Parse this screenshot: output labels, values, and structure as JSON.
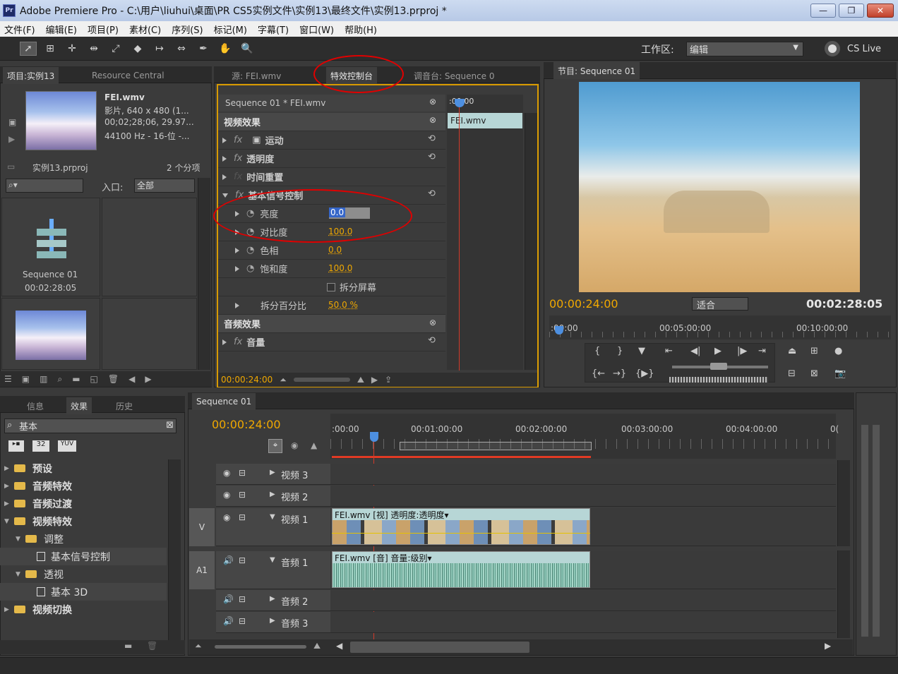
{
  "window": {
    "title": "Adobe Premiere Pro - C:\\用户\\liuhui\\桌面\\PR CS5实例文件\\实例13\\最终文件\\实例13.prproj *",
    "icon": "Pr",
    "min": "—",
    "max": "❐",
    "close": "✕"
  },
  "menu": [
    "文件(F)",
    "编辑(E)",
    "项目(P)",
    "素材(C)",
    "序列(S)",
    "标记(M)",
    "字幕(T)",
    "窗口(W)",
    "帮助(H)"
  ],
  "toolbar": {
    "tools": [
      "selection-tool",
      "track-select-tool",
      "ripple-edit-tool",
      "rolling-edit-tool",
      "rate-stretch-tool",
      "razor-tool",
      "slip-tool",
      "slide-tool",
      "pen-tool",
      "hand-tool",
      "zoom-tool"
    ],
    "glyphs": [
      "➚",
      "⊞",
      "✛",
      "⇹",
      "⤢",
      "◆",
      "↦",
      "⇔",
      "✒",
      "✋",
      "🔍"
    ],
    "workspace_label": "工作区:",
    "workspace_value": "编辑",
    "cslive": "CS Live"
  },
  "project": {
    "tabs": [
      "项目:实例13",
      "Resource Central"
    ],
    "clip_name": "FEI.wmv",
    "clip_line1": "影片, 640 x 480 (1...",
    "clip_line2": "00;02;28;06, 29.97...",
    "clip_line3": "44100 Hz - 16-位 -...",
    "project_file": "实例13.prproj",
    "item_count": "2 个分项",
    "in_label": "入口:",
    "in_value": "全部",
    "seq_name": "Sequence 01",
    "seq_duration": "00:02:28:05"
  },
  "effect_controls": {
    "tabs": [
      "源: FEI.wmv",
      "特效控制台",
      "调音台: Sequence 0"
    ],
    "clip_path": "Sequence 01 * FEI.wmv",
    "time_head": ":00:00",
    "clip_bar": "FEI.wmv",
    "video_effects": "视频效果",
    "effects": [
      "运动",
      "透明度",
      "时间重置",
      "基本信号控制"
    ],
    "params": [
      {
        "label": "亮度",
        "value": "0.0"
      },
      {
        "label": "对比度",
        "value": "100.0"
      },
      {
        "label": "色相",
        "value": "0.0"
      },
      {
        "label": "饱和度",
        "value": "100.0"
      }
    ],
    "split_screen": "拆分屏幕",
    "split_percent_label": "拆分百分比",
    "split_percent_value": "50.0 %",
    "audio_effects": "音频效果",
    "volume": "音量",
    "timecode": "00:00:24:00"
  },
  "program": {
    "tab": "节目: Sequence 01",
    "timecode": "00:00:24:00",
    "fit": "适合",
    "duration": "00:02:28:05",
    "ruler": [
      ":00:00",
      "00:05:00:00",
      "00:10:00:00"
    ]
  },
  "effects_panel": {
    "tabs": [
      "信息",
      "效果",
      "历史"
    ],
    "search": "基本",
    "badges": [
      "32",
      "YUV"
    ],
    "tree": [
      {
        "label": "预设",
        "level": 0,
        "kind": "folder"
      },
      {
        "label": "音频特效",
        "level": 0,
        "kind": "folder"
      },
      {
        "label": "音频过渡",
        "level": 0,
        "kind": "folder"
      },
      {
        "label": "视频特效",
        "level": 0,
        "kind": "folder"
      },
      {
        "label": "调整",
        "level": 1,
        "kind": "folder"
      },
      {
        "label": "基本信号控制",
        "level": 2,
        "kind": "effect"
      },
      {
        "label": "透视",
        "level": 1,
        "kind": "folder"
      },
      {
        "label": "基本 3D",
        "level": 2,
        "kind": "effect"
      },
      {
        "label": "视频切换",
        "level": 0,
        "kind": "folder"
      }
    ]
  },
  "timeline": {
    "tab": "Sequence 01",
    "timecode": "00:00:24:00",
    "ruler": [
      ":00:00",
      "00:01:00:00",
      "00:02:00:00",
      "00:03:00:00",
      "00:04:00:00",
      "0("
    ],
    "tracks": [
      {
        "label": "视频 3",
        "target": ""
      },
      {
        "label": "视频 2",
        "target": ""
      },
      {
        "label": "视频 1",
        "target": "V"
      },
      {
        "label": "音频 1",
        "target": "A1"
      },
      {
        "label": "音频 2",
        "target": ""
      },
      {
        "label": "音频 3",
        "target": ""
      }
    ],
    "video_clip": "FEI.wmv [视] 透明度:透明度▾",
    "audio_clip": "FEI.wmv [音] 音量:级别▾"
  }
}
